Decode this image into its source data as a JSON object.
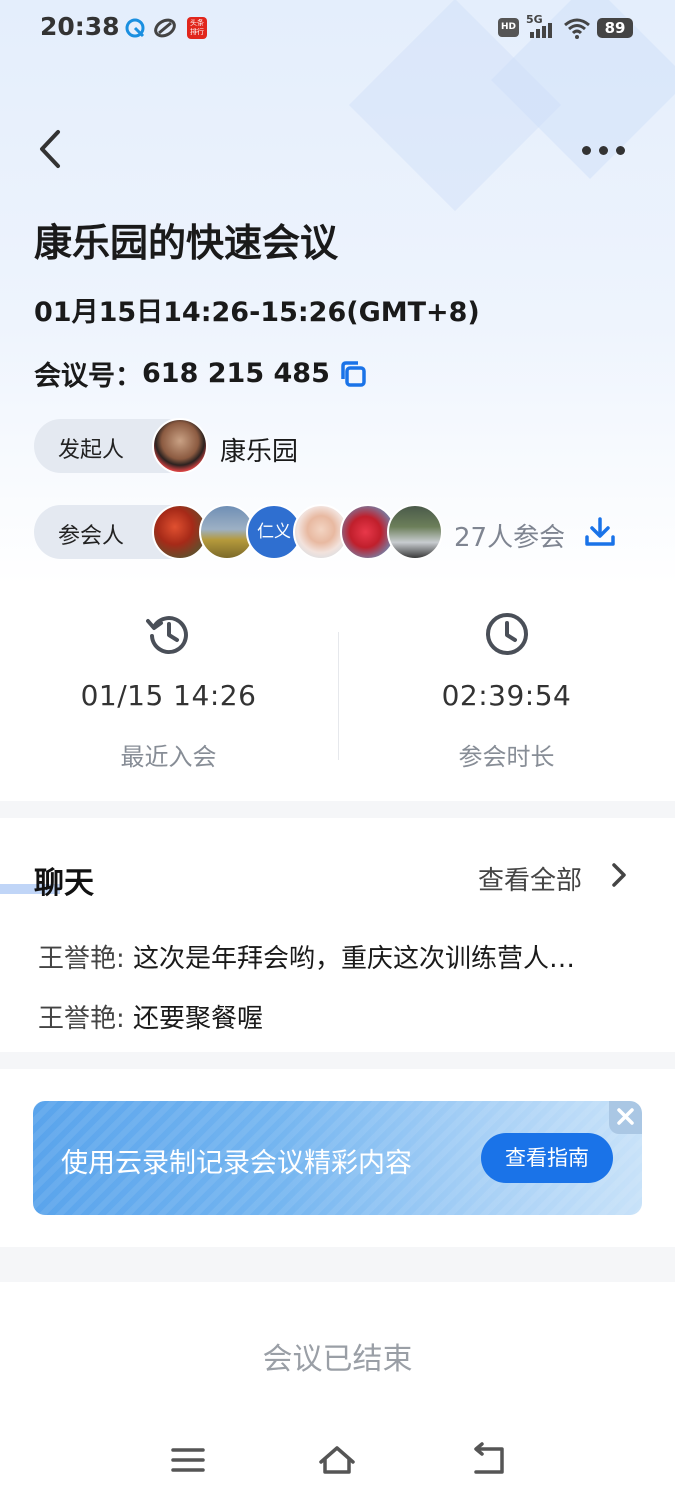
{
  "status_bar": {
    "time": "20:38",
    "hd": "HD",
    "network": "5G",
    "battery": "89",
    "app_badge": "头条\n排行"
  },
  "header": {
    "title": "康乐园的快速会议",
    "time_range": "01月15日14:26-15:26(GMT+8)",
    "meeting_id_label": "会议号：",
    "meeting_id": "618 215 485"
  },
  "host": {
    "label": "发起人",
    "name": "康乐园"
  },
  "attendees": {
    "label": "参会人",
    "avatar_text": "仁义",
    "count_text": "27人参会"
  },
  "stats": {
    "recent_join_value": "01/15 14:26",
    "recent_join_label": "最近入会",
    "duration_value": "02:39:54",
    "duration_label": "参会时长"
  },
  "chat": {
    "title": "聊天",
    "view_all": "查看全部",
    "messages": [
      {
        "sender": "王誉艳:",
        "text": "这次是年拜会哟，重庆这次训练营人…"
      },
      {
        "sender": "王誉艳:",
        "text": "还要聚餐喔"
      }
    ]
  },
  "banner": {
    "text": "使用云录制记录会议精彩内容",
    "button": "查看指南"
  },
  "footer": {
    "ended_text": "会议已结束"
  },
  "colors": {
    "accent": "#1a73e8",
    "header_bg": "#e4eefc",
    "muted_text": "#878d96"
  }
}
